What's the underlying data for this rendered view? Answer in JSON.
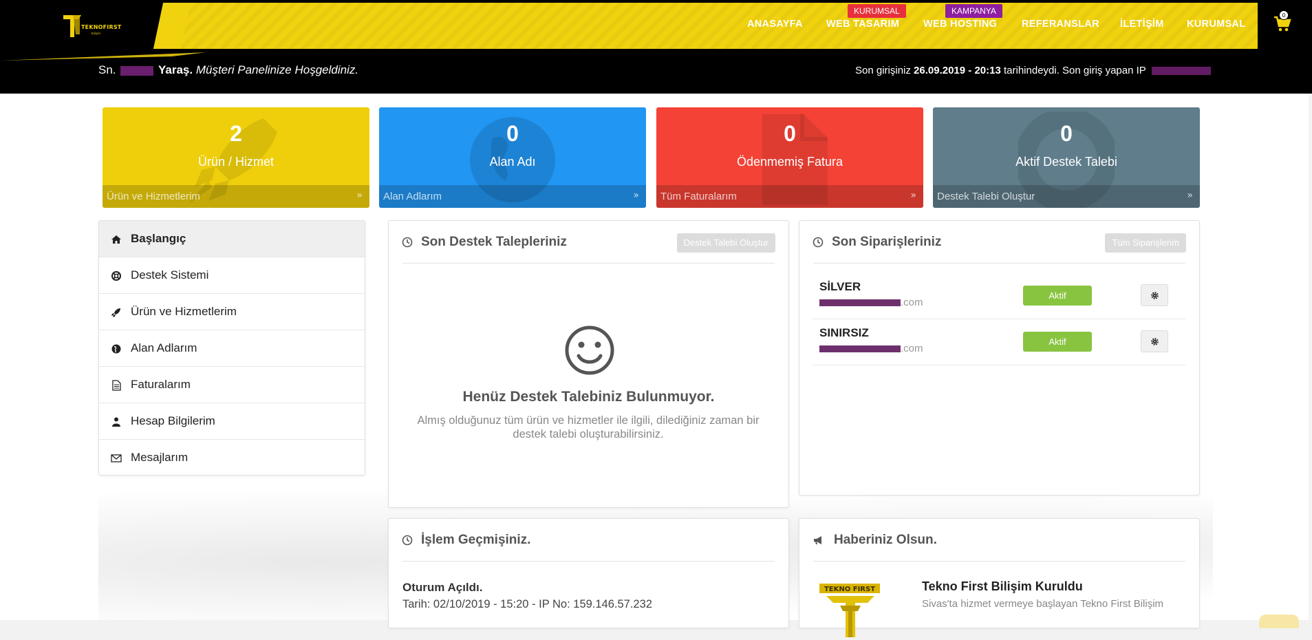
{
  "header": {
    "logo_text": "TEKNOFIRST",
    "logo_sub": "bilişim",
    "nav": [
      {
        "label": "ANASAYFA"
      },
      {
        "label": "WEB TASARIM",
        "badge": "KURUMSAL"
      },
      {
        "label": "WEB HOSTING",
        "badge": "KAMPANYA"
      },
      {
        "label": "REFERANSLAR"
      },
      {
        "label": "İLETİŞİM"
      },
      {
        "label": "KURUMSAL"
      }
    ],
    "cart_count": "0",
    "welcome_prefix": "Sn.",
    "welcome_name": "Yaraş.",
    "welcome_message": "Müşteri Panelinize Hoşgeldiniz.",
    "last_login_prefix": "Son girişiniz",
    "last_login_date": "26.09.2019 - 20:13",
    "last_login_suffix": "tarihindeydi. Son giriş yapan IP"
  },
  "colors": {
    "brand_yellow": "#f1d20f",
    "card_yellow": "#efcf0c",
    "card_blue": "#2196f3",
    "card_red": "#f44236",
    "card_slate": "#5f7d8b",
    "status_green": "#88c440"
  },
  "stats": [
    {
      "value": "2",
      "label": "Ürün / Hizmet",
      "link": "Ürün ve Hizmetlerim",
      "icon": "rocket-icon"
    },
    {
      "value": "0",
      "label": "Alan Adı",
      "link": "Alan Adlarım",
      "icon": "globe-icon"
    },
    {
      "value": "0",
      "label": "Ödenmemiş Fatura",
      "link": "Tüm Faturalarım",
      "icon": "document-icon"
    },
    {
      "value": "0",
      "label": "Aktif Destek Talebi",
      "link": "Destek Talebi Oluştur",
      "icon": "lifebuoy-icon"
    }
  ],
  "sidebar": {
    "items": [
      {
        "label": "Başlangıç",
        "icon": "home-icon"
      },
      {
        "label": "Destek Sistemi",
        "icon": "lifebuoy-icon"
      },
      {
        "label": "Ürün ve Hizmetlerim",
        "icon": "rocket-icon"
      },
      {
        "label": "Alan Adlarım",
        "icon": "globe-icon"
      },
      {
        "label": "Faturalarım",
        "icon": "document-icon"
      },
      {
        "label": "Hesap Bilgilerim",
        "icon": "user-icon"
      },
      {
        "label": "Mesajlarım",
        "icon": "envelope-icon"
      }
    ]
  },
  "support": {
    "title": "Son Destek Talepleriniz",
    "button": "Destek Talebi Oluştur",
    "empty_title": "Henüz Destek Talebiniz Bulunmuyor.",
    "empty_text": "Almış olduğunuz tüm ürün ve hizmetler ile ilgili, dilediğiniz zaman bir destek talebi oluşturabilirsiniz."
  },
  "orders": {
    "title": "Son Siparişleriniz",
    "button": "Tüm Siparişlerim",
    "rows": [
      {
        "name": "SİLVER",
        "domain_suffix": ".com",
        "status": "Aktif"
      },
      {
        "name": "SINIRSIZ",
        "domain_suffix": ".com",
        "status": "Aktif"
      }
    ]
  },
  "history": {
    "title": "İşlem Geçmişiniz.",
    "entry_title": "Oturum Açıldı.",
    "entry_text": "Tarih: 02/10/2019 - 15:20 - IP No: 159.146.57.232"
  },
  "news": {
    "title": "Haberiniz Olsun.",
    "item_title": "Tekno First Bilişim Kuruldu",
    "item_text": "Sivas'ta hizmet vermeye başlayan Tekno First Bilişim",
    "image_text": "TEKNO FIRST"
  }
}
